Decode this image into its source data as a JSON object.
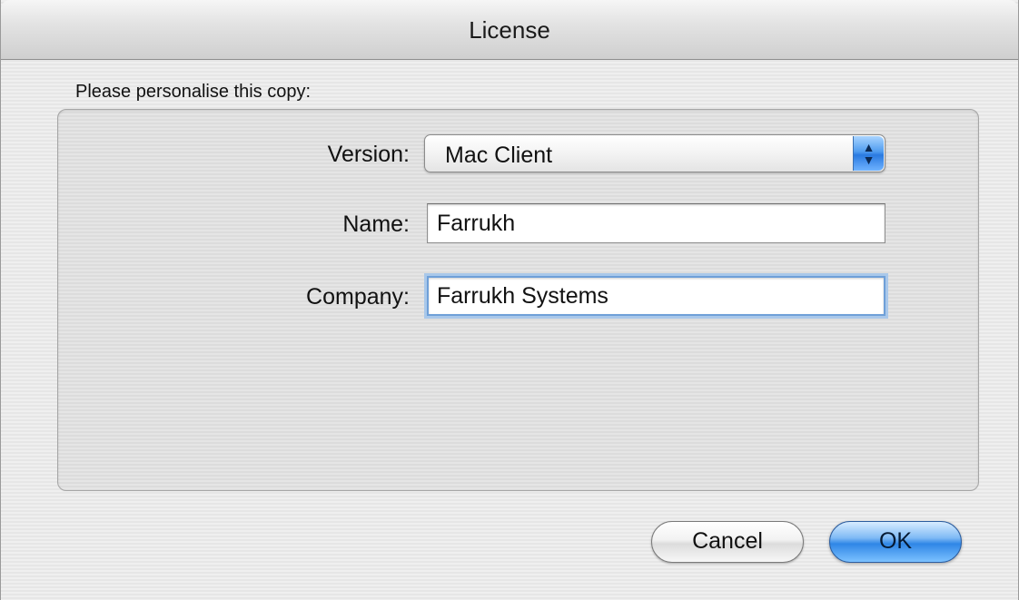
{
  "window": {
    "title": "License"
  },
  "form": {
    "prompt": "Please personalise this copy:",
    "version": {
      "label": "Version:",
      "value": "Mac Client",
      "icon": "updown-arrows-icon"
    },
    "name": {
      "label": "Name:",
      "value": "Farrukh"
    },
    "company": {
      "label": "Company:",
      "value": "Farrukh Systems"
    }
  },
  "buttons": {
    "cancel_label": "Cancel",
    "ok_label": "OK"
  },
  "colors": {
    "accent": "#2f86e6",
    "focus_ring": "#a9c8ea",
    "window_bg": "#ececec"
  }
}
